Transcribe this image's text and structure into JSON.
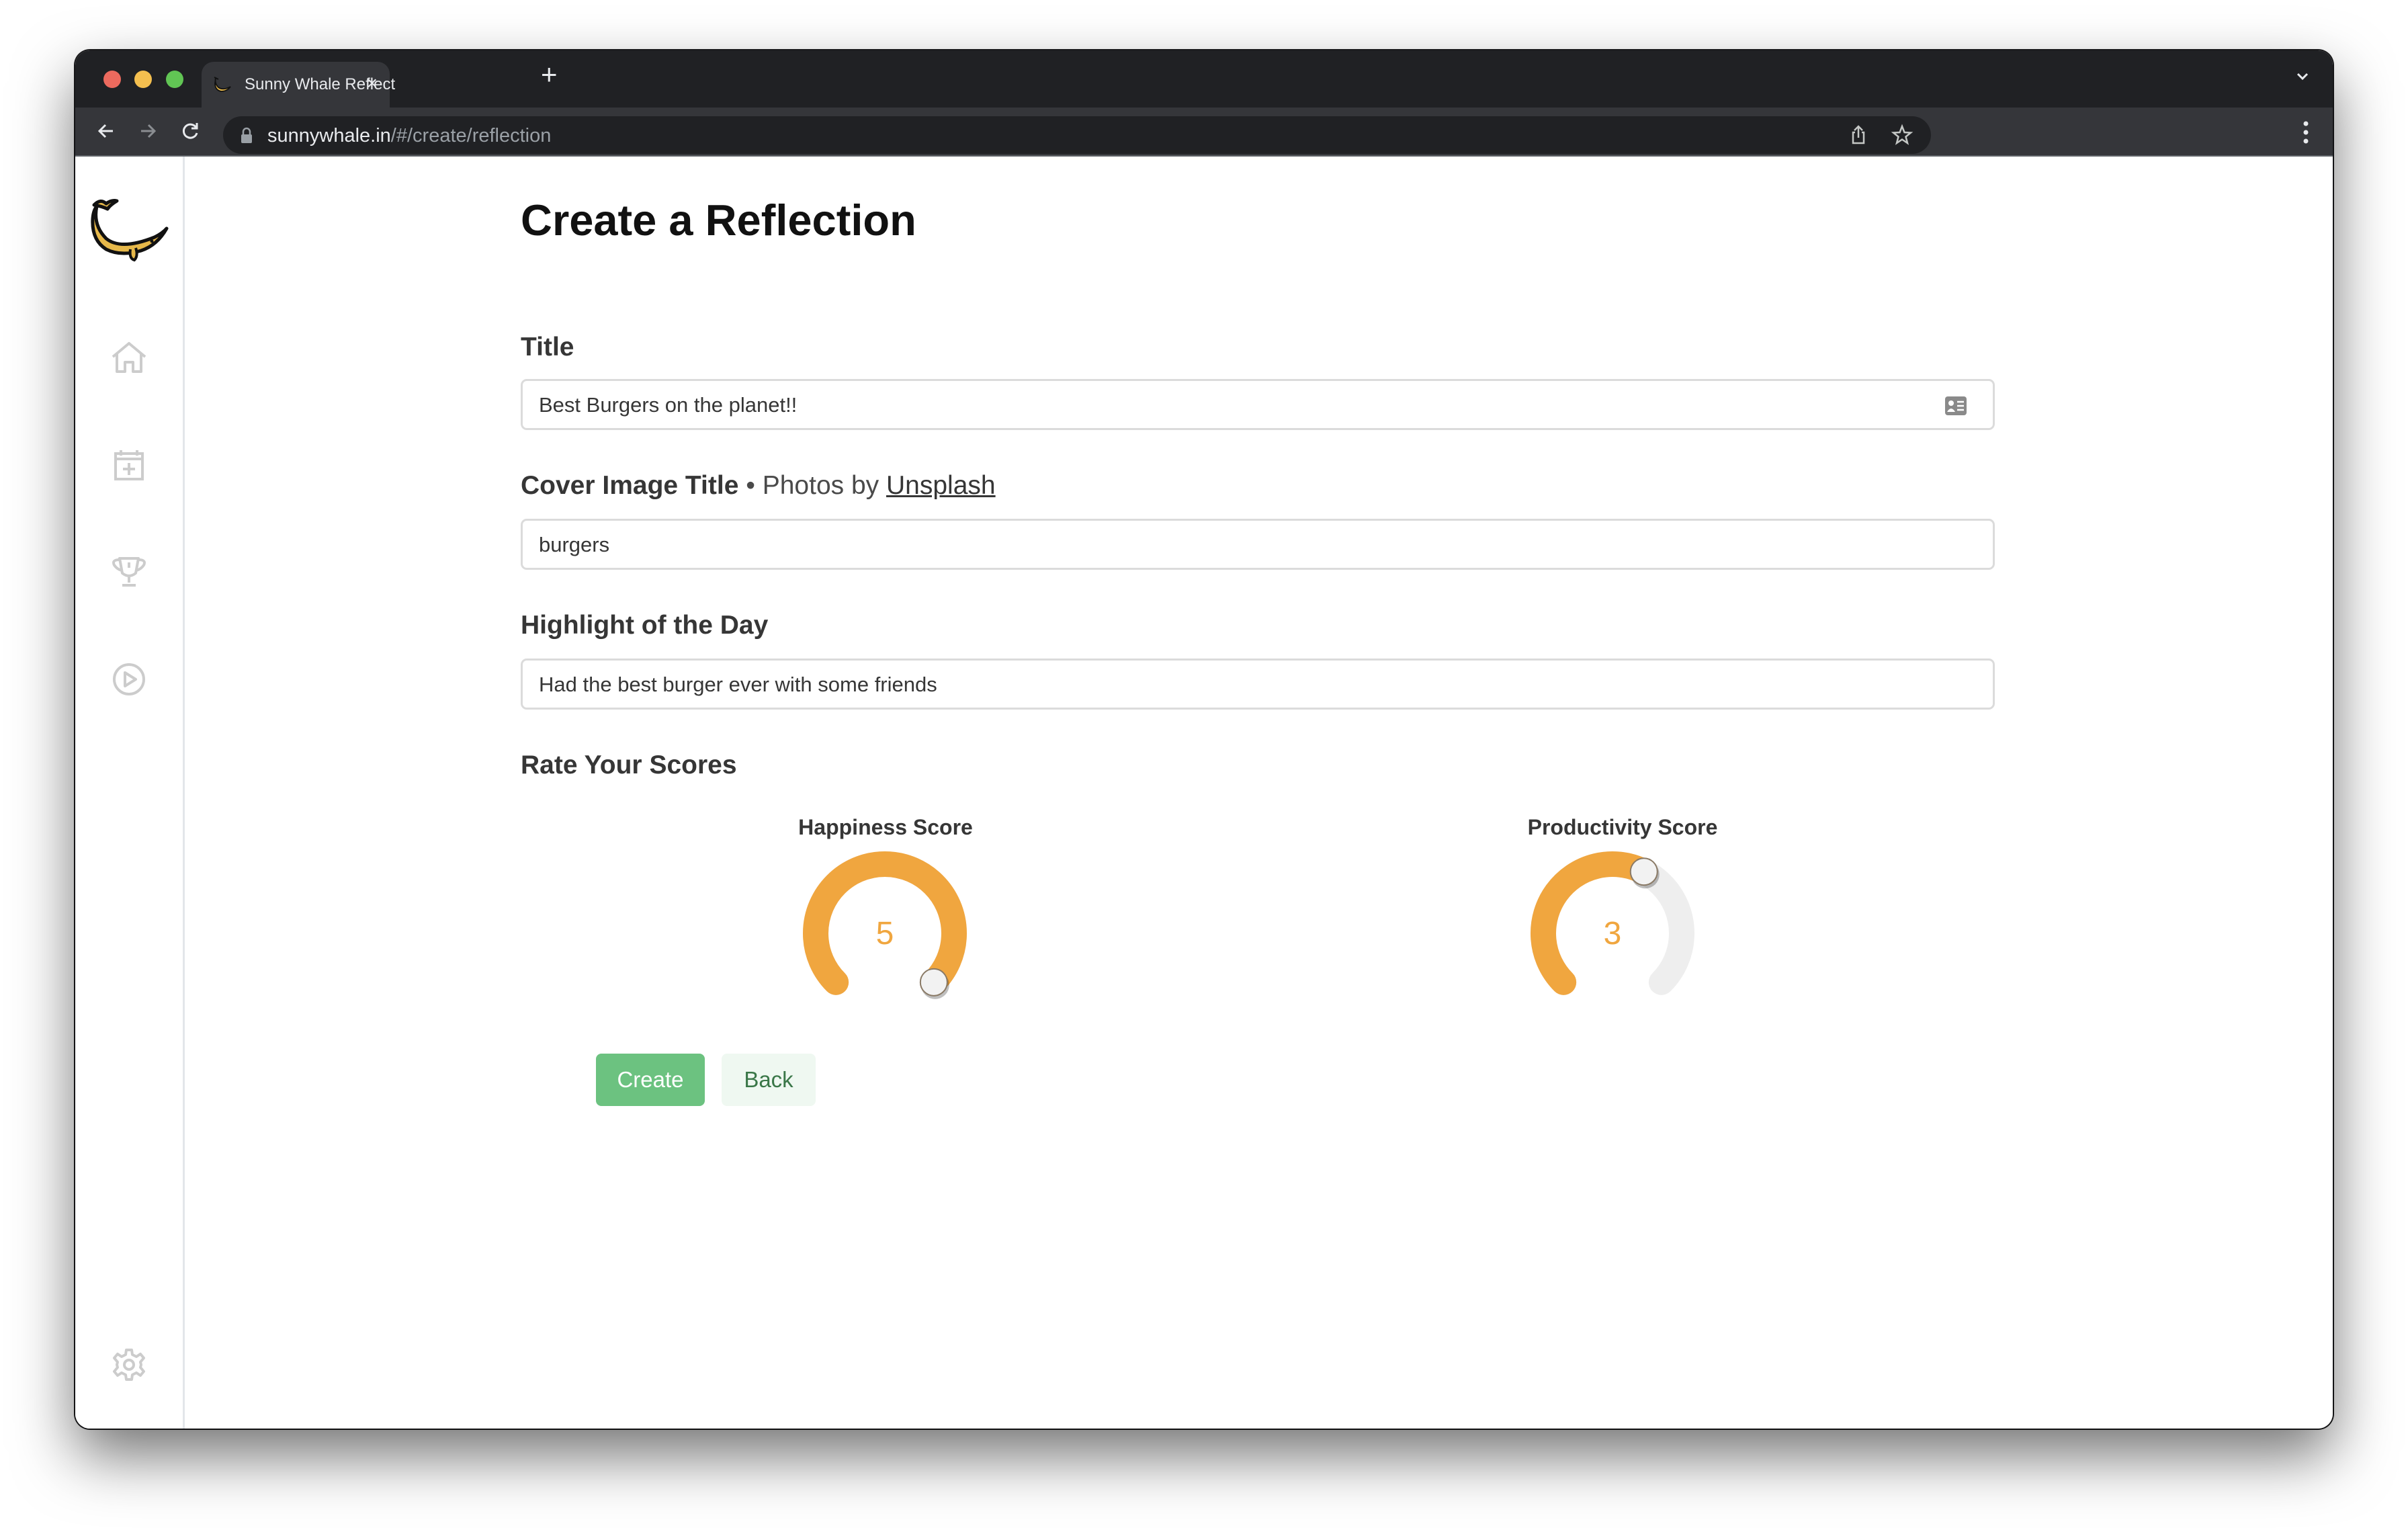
{
  "browser": {
    "tab_title": "Sunny Whale Reflect",
    "tab_close": "×",
    "new_tab": "+",
    "url_host": "sunnywhale.in",
    "url_path": "/#/create/reflection"
  },
  "sidebar": {
    "items": [
      {
        "name": "home",
        "icon": "home-icon"
      },
      {
        "name": "new-entry",
        "icon": "calendar-plus-icon"
      },
      {
        "name": "achievements",
        "icon": "trophy-icon"
      },
      {
        "name": "play",
        "icon": "play-circle-icon"
      }
    ],
    "settings_icon": "gear-icon"
  },
  "form": {
    "heading": "Create a Reflection",
    "title_label": "Title",
    "title_value": "Best Burgers on the planet!!",
    "cover_label": "Cover Image Title",
    "cover_separator": " • Photos by ",
    "cover_link": "Unsplash",
    "cover_value": "burgers",
    "highlight_label": "Highlight of the Day",
    "highlight_value": "Had the best burger ever with some friends",
    "scores_label": "Rate Your Scores"
  },
  "scores": {
    "max": 5,
    "happiness": {
      "label": "Happiness Score",
      "value": 5
    },
    "productivity": {
      "label": "Productivity Score",
      "value": 3
    }
  },
  "buttons": {
    "create": "Create",
    "back": "Back"
  },
  "colors": {
    "accent": "#f0a63f",
    "track": "#eeeeee",
    "primary_button": "#6cc280",
    "secondary_button": "#eff8f1"
  }
}
